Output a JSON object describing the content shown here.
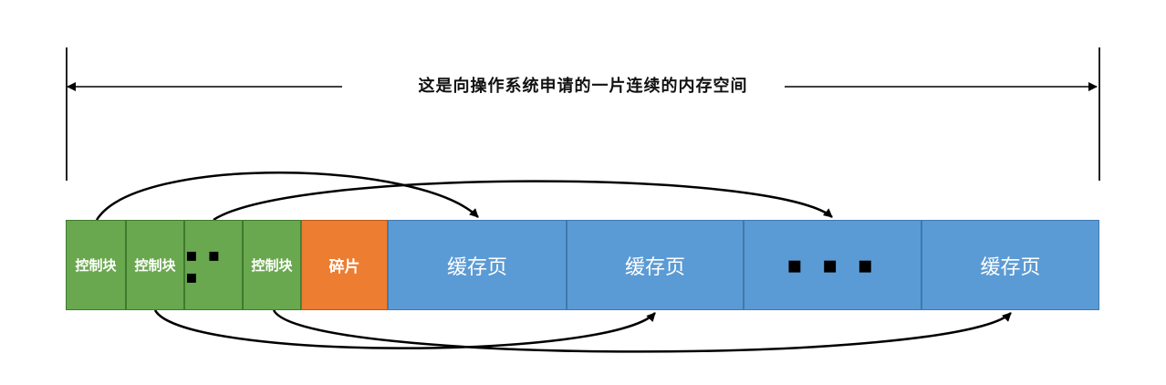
{
  "span_label": "这是向操作系统申请的一片连续的内存空间",
  "blocks": {
    "ctrl1": "控制块",
    "ctrl2": "控制块",
    "ctrl_dots": "▪ ▪ ▪",
    "ctrl3": "控制块",
    "fragment": "碎片",
    "page1": "缓存页",
    "page2": "缓存页",
    "page_dots": "▪ ▪ ▪",
    "page3": "缓存页"
  },
  "colors": {
    "control_block": "#6aa84f",
    "fragment": "#ed7d31",
    "cache_page": "#5b9bd5",
    "line": "#000000"
  }
}
